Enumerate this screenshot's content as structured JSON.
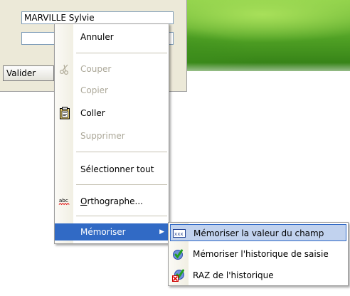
{
  "form": {
    "name_value": "MARVILLE Sylvie",
    "second_value": "",
    "valider_label": "Valider"
  },
  "context_menu": {
    "items": [
      {
        "label": "Annuler",
        "enabled": true,
        "icon": ""
      },
      {
        "label": "Couper",
        "enabled": false,
        "icon": "scissors-icon"
      },
      {
        "label": "Copier",
        "enabled": false,
        "icon": "copy-icon"
      },
      {
        "label": "Coller",
        "enabled": true,
        "icon": "clipboard-icon"
      },
      {
        "label": "Supprimer",
        "enabled": false,
        "icon": ""
      },
      {
        "label": "Sélectionner tout",
        "enabled": true,
        "icon": ""
      },
      {
        "label_prefix": "O",
        "label_rest": "rthographe...",
        "enabled": true,
        "icon": "spellcheck-icon",
        "icon_text": "abc"
      },
      {
        "label": "Mémoriser",
        "enabled": true,
        "highlighted": true,
        "has_submenu": true,
        "icon": "",
        "arrow": "▶"
      }
    ]
  },
  "submenu": {
    "items": [
      {
        "label": "Mémoriser la valeur du champ",
        "highlighted": true,
        "icon": "field-value-icon"
      },
      {
        "label": "Mémoriser l'historique de saisie",
        "highlighted": false,
        "icon": "history-icon"
      },
      {
        "label": "RAZ de l'historique",
        "highlighted": false,
        "icon": "clear-history-icon"
      }
    ]
  },
  "colors": {
    "highlight": "#316ac5",
    "sub_highlight": "#c1d2ee",
    "disabled_text": "#aca899"
  }
}
